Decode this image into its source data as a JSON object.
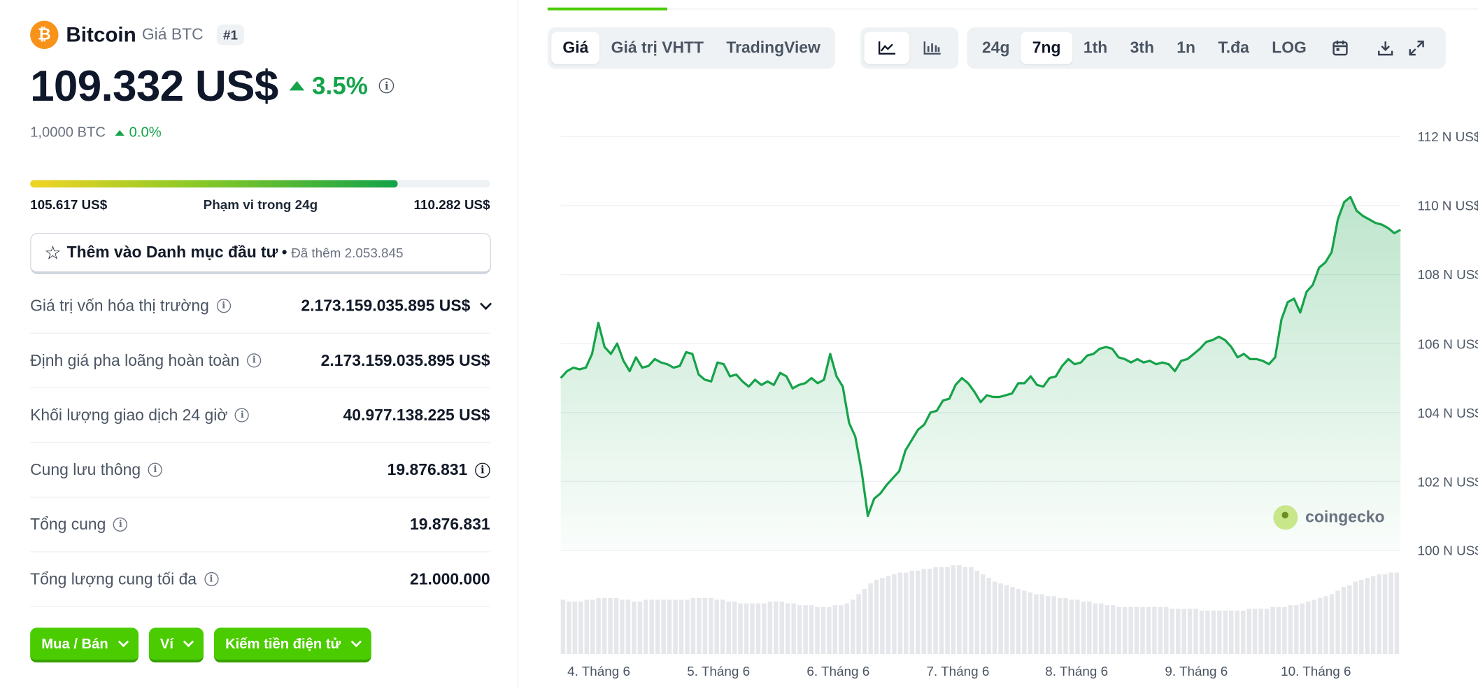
{
  "coin": {
    "name": "Bitcoin",
    "subtitle": "Giá BTC",
    "rank": "#1",
    "logo_symbol": "₿",
    "price": "109.332 US$",
    "change": "3.5%",
    "btc_price": "1,0000 BTC",
    "btc_change": "0.0%"
  },
  "range24h": {
    "low": "105.617 US$",
    "label": "Phạm vi trong 24g",
    "high": "110.282 US$",
    "position_fraction": 0.8
  },
  "portfolio": {
    "label": "Thêm vào Danh mục đầu tư",
    "added": "Đã thêm 2.053.845"
  },
  "stats": [
    {
      "label": "Giá trị vốn hóa thị trường",
      "value": "2.173.159.035.895 US$"
    },
    {
      "label": "Định giá pha loãng hoàn toàn",
      "value": "2.173.159.035.895 US$"
    },
    {
      "label": "Khối lượng giao dịch 24 giờ",
      "value": "40.977.138.225 US$"
    },
    {
      "label": "Cung lưu thông",
      "value": "19.876.831"
    },
    {
      "label": "Tổng cung",
      "value": "19.876.831"
    },
    {
      "label": "Tổng lượng cung tối đa",
      "value": "21.000.000"
    }
  ],
  "buttons": {
    "buy_sell": "Mua / Bán",
    "wallet": "Ví",
    "earn": "Kiếm tiền điện tử"
  },
  "chart_tabs": [
    "Giá",
    "Giá trị VHTT",
    "TradingView"
  ],
  "range_tabs": [
    "24g",
    "7ng",
    "1th",
    "3th",
    "1n",
    "T.đa",
    "LOG"
  ],
  "active_chart_tab": "Giá",
  "active_range_tab": "7ng",
  "watermark": "coingecko",
  "colors": {
    "accent_green": "#4bcc00",
    "up_green": "#16a34a",
    "btc_orange": "#f7931a"
  },
  "chart_data": {
    "type": "area",
    "ylabels": [
      "112 N US$",
      "110 N US$",
      "108 N US$",
      "106 N US$",
      "104 N US$",
      "102 N US$",
      "100 N US$"
    ],
    "ylim": [
      100000,
      112000
    ],
    "xlabels": [
      "4. Tháng 6",
      "5. Tháng 6",
      "6. Tháng 6",
      "7. Tháng 6",
      "8. Tháng 6",
      "9. Tháng 6",
      "10. Tháng 6"
    ],
    "series": [
      {
        "values": [
          105000,
          105200,
          105300,
          105250,
          105300,
          105700,
          106600,
          105900,
          105700,
          106000,
          105500,
          105200,
          105600,
          105300,
          105350,
          105550,
          105450,
          105400,
          105300,
          105350,
          105750,
          105700,
          105100,
          104950,
          104900,
          105450,
          105400,
          105050,
          105100,
          104900,
          104750,
          104950,
          104800,
          104900,
          104800,
          105150,
          105050,
          104700,
          104800,
          104850,
          105000,
          104850,
          104950,
          105700,
          105050,
          104750,
          103700,
          103300,
          102300,
          101000,
          101500,
          101650,
          101900,
          102100,
          102300,
          102900,
          103200,
          103500,
          103650,
          104000,
          104050,
          104350,
          104400,
          104800,
          105000,
          104850,
          104600,
          104300,
          104500,
          104450,
          104450,
          104500,
          104550,
          104850,
          104850,
          105050,
          104800,
          104750,
          105000,
          105050,
          105350,
          105550,
          105400,
          105450,
          105650,
          105700,
          105850,
          105900,
          105850,
          105600,
          105550,
          105450,
          105550,
          105450,
          105500,
          105400,
          105450,
          105400,
          105200,
          105500,
          105550,
          105700,
          105850,
          106050,
          106100,
          106200,
          106100,
          105900,
          105600,
          105700,
          105550,
          105550,
          105500,
          105400,
          105600,
          106700,
          107200,
          107300,
          106900,
          107500,
          107700,
          108200,
          108350,
          108650,
          109600,
          110100,
          110250,
          109850,
          109700,
          109600,
          109500,
          109450,
          109350,
          109200,
          109300
        ]
      },
      {
        "values": [
          30,
          29,
          29,
          29,
          30,
          30,
          31,
          31,
          31,
          31,
          30,
          30,
          29,
          29,
          30,
          30,
          30,
          30,
          30,
          30,
          30,
          30,
          31,
          31,
          31,
          31,
          30,
          30,
          29,
          29,
          28,
          28,
          28,
          28,
          28,
          29,
          29,
          29,
          28,
          28,
          27,
          27,
          27,
          26,
          26,
          26,
          27,
          27,
          28,
          30,
          33,
          36,
          39,
          41,
          42,
          43,
          44,
          45,
          45,
          46,
          46,
          47,
          47,
          48,
          48,
          48,
          49,
          49,
          48,
          48,
          46,
          44,
          42,
          40,
          39,
          38,
          37,
          36,
          35,
          34,
          33,
          33,
          32,
          32,
          31,
          31,
          30,
          30,
          29,
          29,
          28,
          28,
          27,
          27,
          26,
          26,
          26,
          26,
          26,
          26,
          26,
          26,
          26,
          25,
          25,
          25,
          25,
          25,
          24,
          24,
          24,
          24,
          24,
          24,
          24,
          24,
          25,
          25,
          25,
          25,
          26,
          26,
          26,
          27,
          27,
          28,
          29,
          30,
          31,
          32,
          33,
          35,
          37,
          38,
          40,
          41,
          42,
          43,
          44,
          44,
          45,
          45
        ]
      }
    ]
  }
}
